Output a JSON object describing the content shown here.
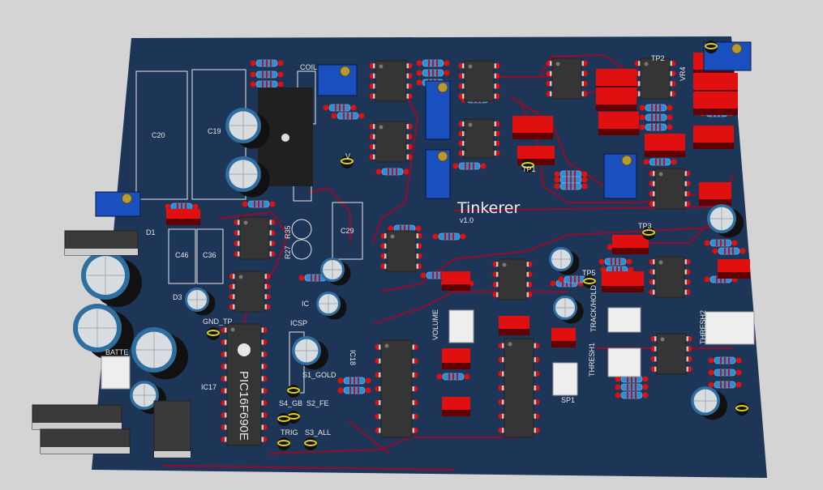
{
  "board": {
    "title": "Tinkerer",
    "version": "v1.0",
    "colors": {
      "substrate": "#1d3556",
      "trace": "#8a1030",
      "pad": "#e01010",
      "silk": "#e8e8e8",
      "background": "#d4d4d4"
    }
  },
  "labels": {
    "c20": "C20",
    "c19": "C19",
    "coil": "COIL",
    "v": "V",
    "c29": "C29",
    "r35": "R35",
    "r27": "R27",
    "c46": "C46",
    "c36": "C36",
    "d1": "D1",
    "d3": "D3",
    "gnd_tp": "GND_TP",
    "battery": "BATTE",
    "ic17": "IC17",
    "ic18": "IC18",
    "ic": "IC",
    "icsp": "ICSP",
    "s1_gold": "S1_GOLD",
    "s2_fe": "S2_FE",
    "s4_gb": "S4_GB",
    "s3_all": "S3_ALL",
    "trig": "TRIG",
    "tp1": "TP1",
    "tp2": "TP2",
    "tp3": "TP3",
    "tp5": "TP5",
    "vr4": "VR4",
    "volume": "VOLUME",
    "track_hold": "TRACK/HOLD",
    "thresh1": "THRESH1",
    "thresh2": "THRESH2",
    "sp1": "SP1"
  },
  "mcu": {
    "part": "PIC16F690E"
  }
}
